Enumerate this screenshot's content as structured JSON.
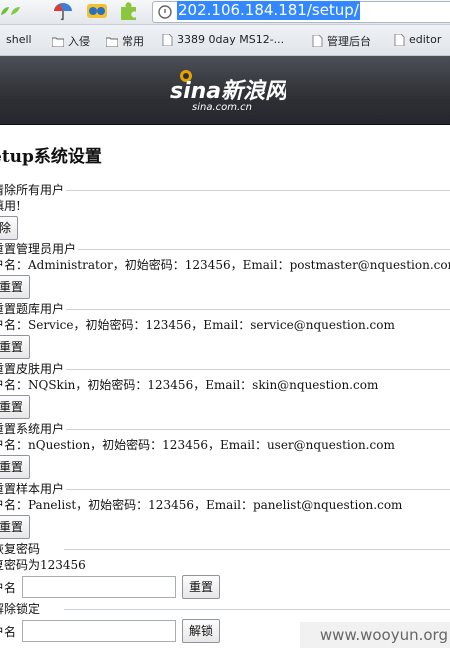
{
  "browser": {
    "url": "202.106.184.181/setup/",
    "bookmarks": [
      {
        "label": "shell"
      },
      {
        "label": "入侵"
      },
      {
        "label": "常用"
      },
      {
        "label": "3389 0day MS12-..."
      },
      {
        "label": "管理后台"
      },
      {
        "label": "editor"
      }
    ]
  },
  "header": {
    "logo_main": "sina新浪网",
    "logo_domain": "sina.com.cn"
  },
  "page": {
    "title": "etup系统设置",
    "sections": {
      "clear_users": {
        "legend": "清除所有用户",
        "info": "慎用!",
        "button": "除"
      },
      "reset_admin": {
        "legend": "重置管理员用户",
        "info": "户名：Administrator，初始密码：123456，Email：postmaster@nquestion.com",
        "button": "重置"
      },
      "reset_bank": {
        "legend": "重置题库用户",
        "info": "户名：Service，初始密码：123456，Email：service@nquestion.com",
        "button": "重置"
      },
      "reset_skin": {
        "legend": "重置皮肤用户",
        "info": "户名：NQSkin，初始密码：123456，Email：skin@nquestion.com",
        "button": "重置"
      },
      "reset_system": {
        "legend": "重置系统用户",
        "info": "户名：nQuestion，初始密码：123456，Email：user@nquestion.com",
        "button": "重置"
      },
      "reset_panel": {
        "legend": "重置样本用户",
        "info": "户名：Panelist，初始密码：123456，Email：panelist@nquestion.com",
        "button": "重置"
      },
      "restore_password": {
        "legend": "恢复密码",
        "info": "复密码为123456",
        "label": "户名",
        "input_value": "",
        "button": "重置"
      },
      "unlock": {
        "legend": "解除锁定",
        "label": "户名",
        "input_value": "",
        "button": "解锁"
      }
    }
  },
  "watermark": "www.wooyun.org"
}
